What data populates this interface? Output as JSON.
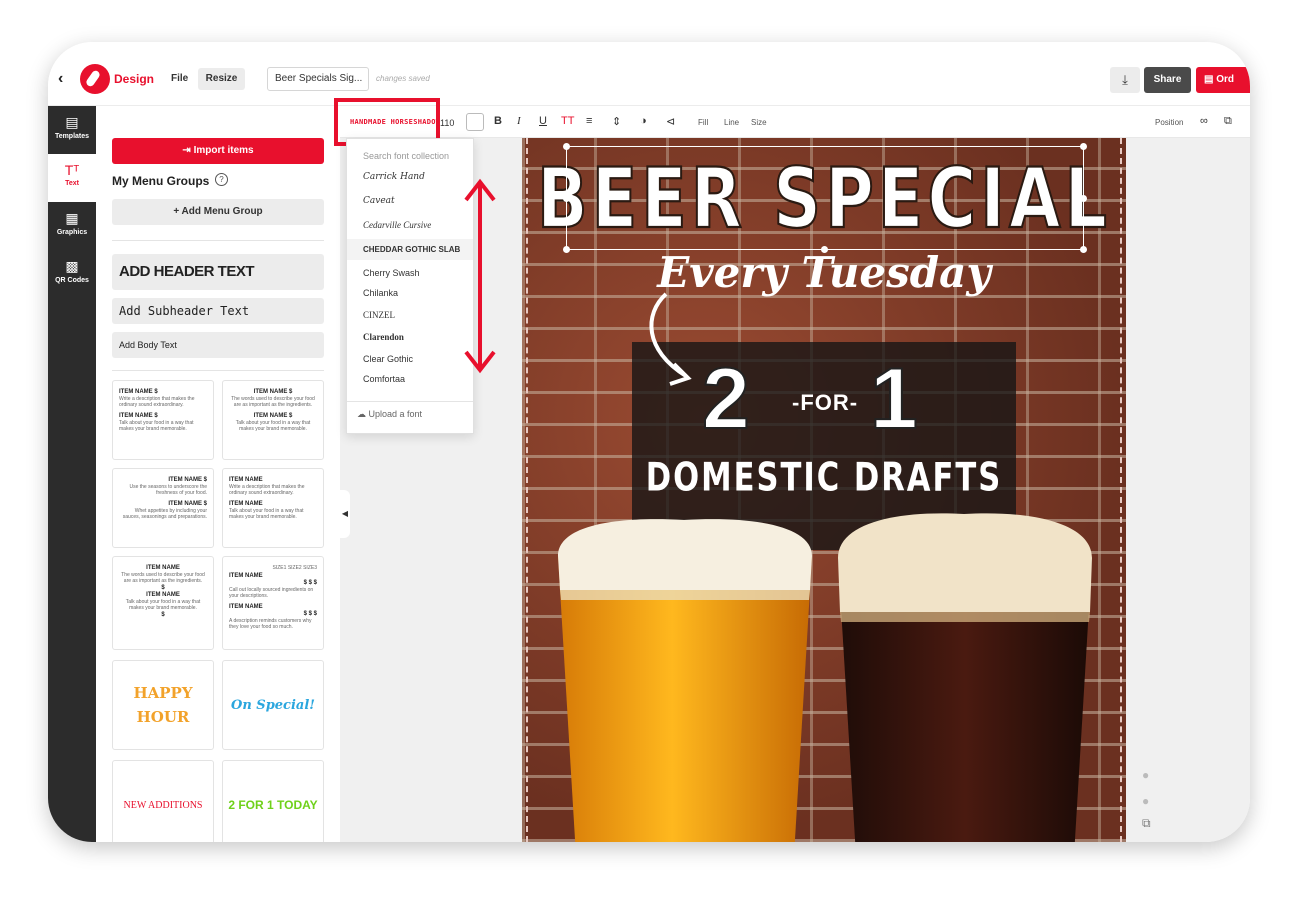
{
  "app": {
    "brand": "Design",
    "menu_file": "File",
    "menu_resize": "Resize",
    "doc_title": "Beer Specials Sig...",
    "save_status": "changes saved",
    "share_label": "Share",
    "order_label": "Ord",
    "back_icon": "chevron-left-icon",
    "download_icon": "download-icon"
  },
  "rail": {
    "items": [
      {
        "label": "Templates",
        "icon": "templates-icon"
      },
      {
        "label": "Text",
        "icon": "text-icon"
      },
      {
        "label": "Graphics",
        "icon": "image-icon"
      },
      {
        "label": "QR Codes",
        "icon": "qr-code-icon"
      }
    ],
    "active": "Text"
  },
  "panel": {
    "import_label": "Import items",
    "groups_title": "My Menu Groups",
    "help": "?",
    "add_group_label": "+ Add Menu Group",
    "header_text": "ADD HEADER TEXT",
    "subheader_text": "Add Subheader Text",
    "body_text": "Add Body Text",
    "cards": [
      {
        "item1": "ITEM NAME $",
        "desc1": "Write a description that makes the ordinary sound extraordinary.",
        "item2": "ITEM NAME $",
        "desc2": "Talk about your food in a way that makes your brand memorable."
      },
      {
        "item1": "ITEM NAME $",
        "desc1": "The words used to describe your food are as important as the ingredients.",
        "item2": "ITEM NAME $",
        "desc2": "Talk about your food in a way that makes your brand memorable."
      },
      {
        "item1": "ITEM NAME $",
        "desc1": "Use the seasons to underscore the freshness of your food.",
        "item2": "ITEM NAME $",
        "desc2": "Whet appetites by including your sauces, seasonings and preparations."
      },
      {
        "item1": "ITEM NAME",
        "desc1": "Write a description that makes the ordinary sound extraordinary.",
        "item2": "ITEM NAME",
        "desc2": "Talk about your food in a way that makes your brand memorable."
      },
      {
        "item1": "ITEM NAME",
        "desc1": "The words used to describe your food are as important as the ingredients.",
        "price1": "$",
        "item2": "ITEM NAME",
        "desc2": "Talk about your food in a way that makes your brand memorable.",
        "price2": "$"
      },
      {
        "sizes": "SIZE1  SIZE2  SIZE3",
        "item1": "ITEM NAME",
        "prices1": "$   $   $",
        "desc1": "Call out locally sourced ingredients on your descriptions.",
        "item2": "ITEM NAME",
        "prices2": "$   $   $",
        "desc2": "A description reminds customers why they love your food so much."
      }
    ],
    "happy_hour": "HAPPY HOUR",
    "on_special": "On Special!",
    "new_additions": "NEW ADDITIONS",
    "two_for_one": "2 FOR 1 TODAY"
  },
  "toolbar": {
    "font_name": "HANDMADE HORSESHADOW",
    "font_size": "110",
    "bold": "B",
    "italic": "I",
    "underline": "U",
    "text_case": "TT",
    "fill": "Fill",
    "line": "Line",
    "size": "Size",
    "position": "Position",
    "align_icon": "align-center-icon",
    "spacing_icon": "line-spacing-icon",
    "opacity_icon": "opacity-icon",
    "effects_icon": "effects-icon",
    "link_icon": "link-icon",
    "layers_icon": "layers-icon"
  },
  "font_dropdown": {
    "search_placeholder": "Search font collection",
    "fonts": [
      "Carrick Hand",
      "Caveat",
      "Cedarville Cursive",
      "CHEDDAR GOTHIC SLAB",
      "Cherry Swash",
      "Chilanka",
      "CINZEL",
      "Clarendon",
      "Clear Gothic",
      "Comfortaa"
    ],
    "selected": "CHEDDAR GOTHIC SLAB",
    "upload_label": "Upload a font",
    "upload_icon": "cloud-upload-icon"
  },
  "poster": {
    "headline": "BEER SPECIAL",
    "day": "Every Tuesday",
    "num_a": "2",
    "for": "-FOR-",
    "num_b": "1",
    "subline": "DOMESTIC DRAFTS"
  },
  "colors": {
    "accent": "#e8102d",
    "rail_bg": "#2c2c2c",
    "share_bg": "#4a4a4a"
  }
}
